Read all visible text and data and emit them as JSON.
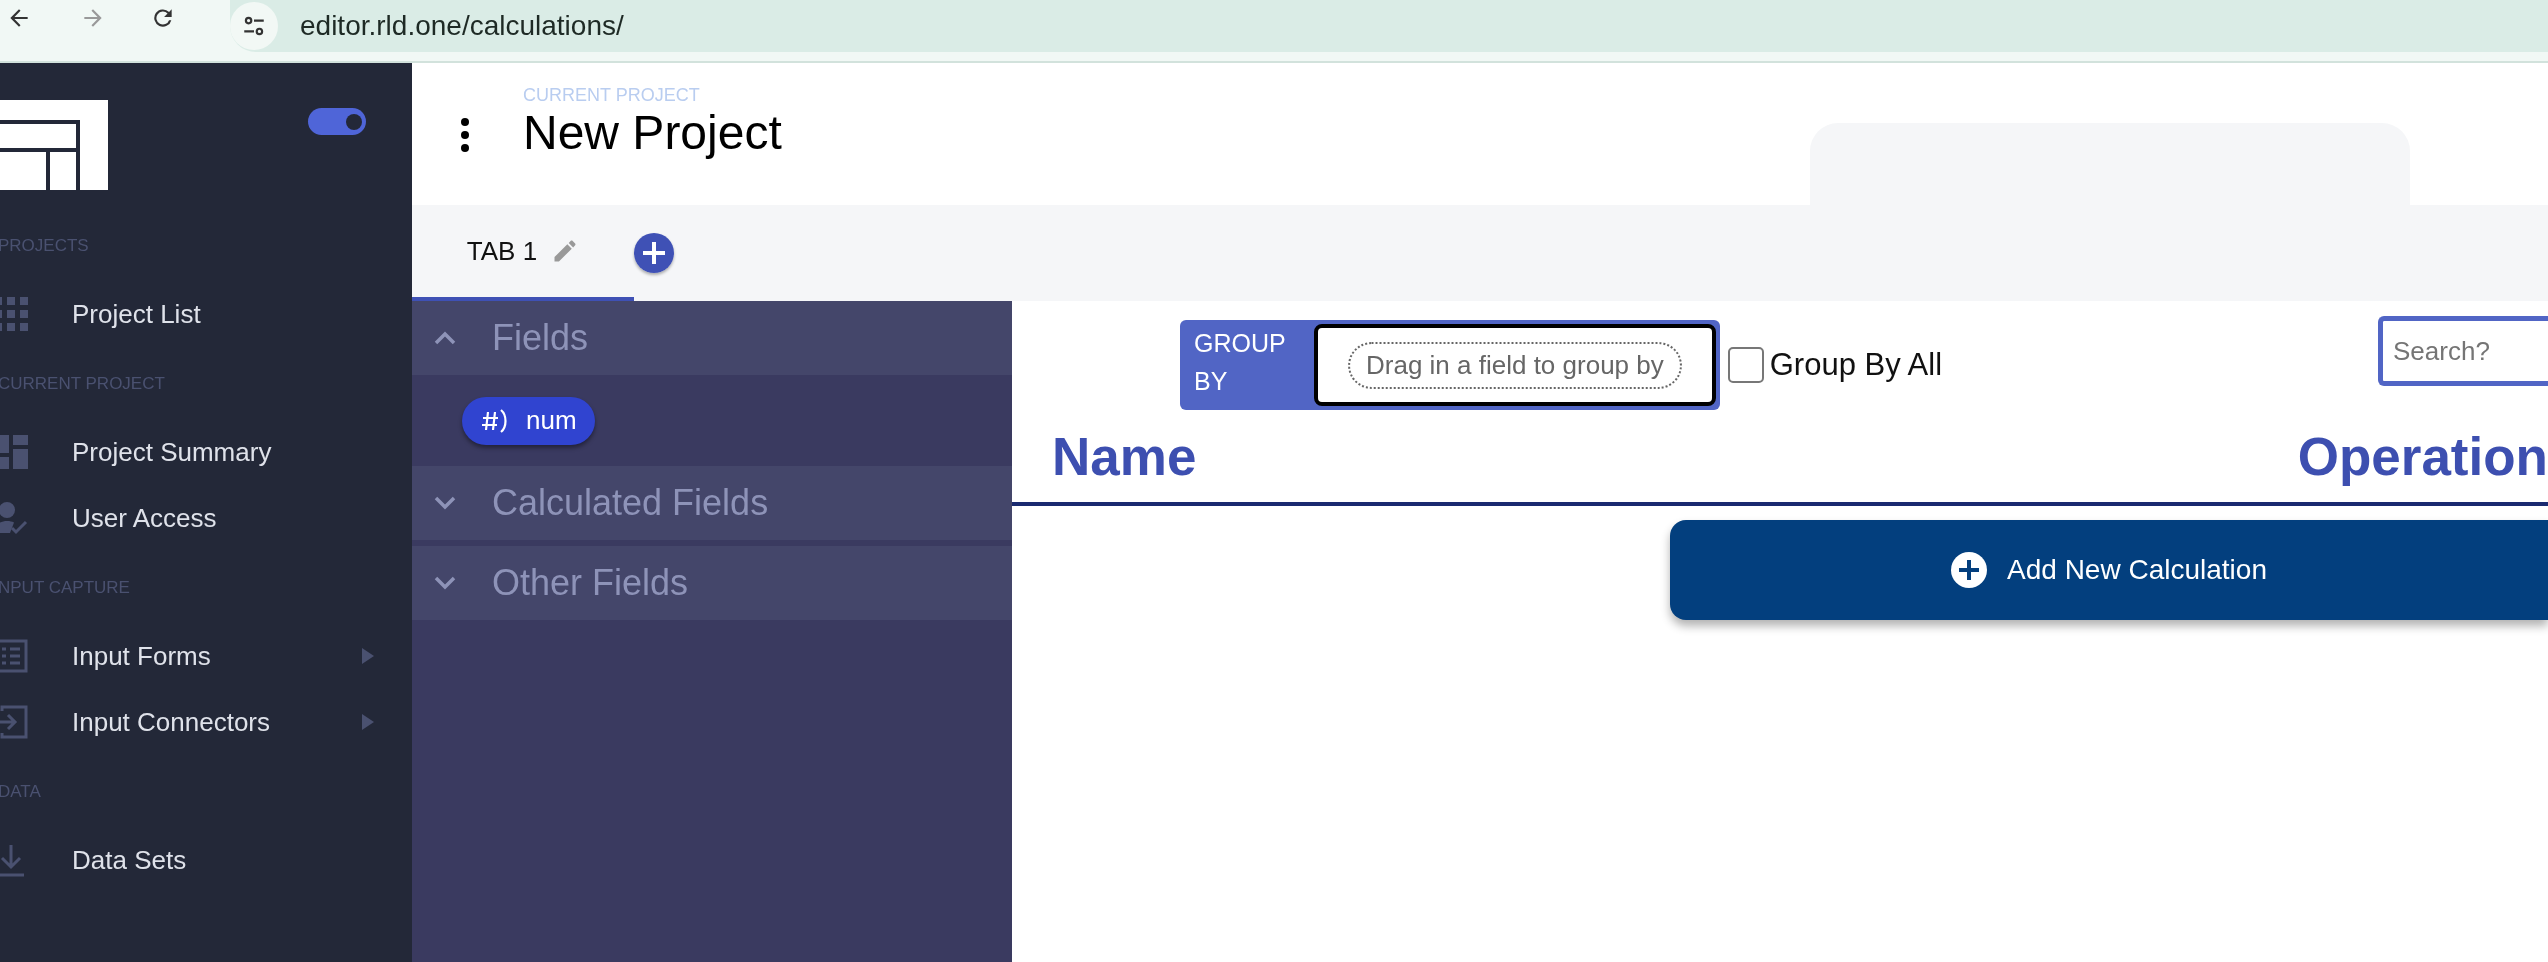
{
  "browser": {
    "url": "editor.rld.one/calculations/"
  },
  "sidebar": {
    "toggle": {
      "on": true
    },
    "sections": [
      {
        "label": "PROJECTS",
        "items": [
          {
            "label": "Project List",
            "kind": "grid",
            "submenu": false
          }
        ]
      },
      {
        "label": "CURRENT PROJECT",
        "items": [
          {
            "label": "Project Summary",
            "kind": "dashboard",
            "submenu": false
          },
          {
            "label": "User Access",
            "kind": "user",
            "submenu": false
          }
        ]
      },
      {
        "label": "NPUT CAPTURE",
        "items": [
          {
            "label": "Input Forms",
            "kind": "list",
            "submenu": true
          },
          {
            "label": "Input Connectors",
            "kind": "login",
            "submenu": true
          }
        ]
      },
      {
        "label": "DATA",
        "items": [
          {
            "label": "Data Sets",
            "kind": "download",
            "submenu": false
          }
        ]
      }
    ]
  },
  "header": {
    "label": "CURRENT PROJECT",
    "title": "New Project"
  },
  "tabs": [
    {
      "label": "TAB 1",
      "selected": true
    }
  ],
  "fields_panel": {
    "groups": [
      {
        "title": "Fields",
        "expanded": true,
        "chips": [
          {
            "label": "num"
          }
        ]
      },
      {
        "title": "Calculated Fields",
        "expanded": false
      },
      {
        "title": "Other Fields",
        "expanded": false
      }
    ]
  },
  "toolbar": {
    "group_by_label": "GROUP BY",
    "drop_placeholder": "Drag in a field to group by",
    "group_by_all": {
      "label": "Group By All",
      "checked": false
    },
    "search": {
      "placeholder": "Search?"
    }
  },
  "table": {
    "columns": [
      "Name",
      "Operation"
    ]
  },
  "add_button": "Add New Calculation"
}
